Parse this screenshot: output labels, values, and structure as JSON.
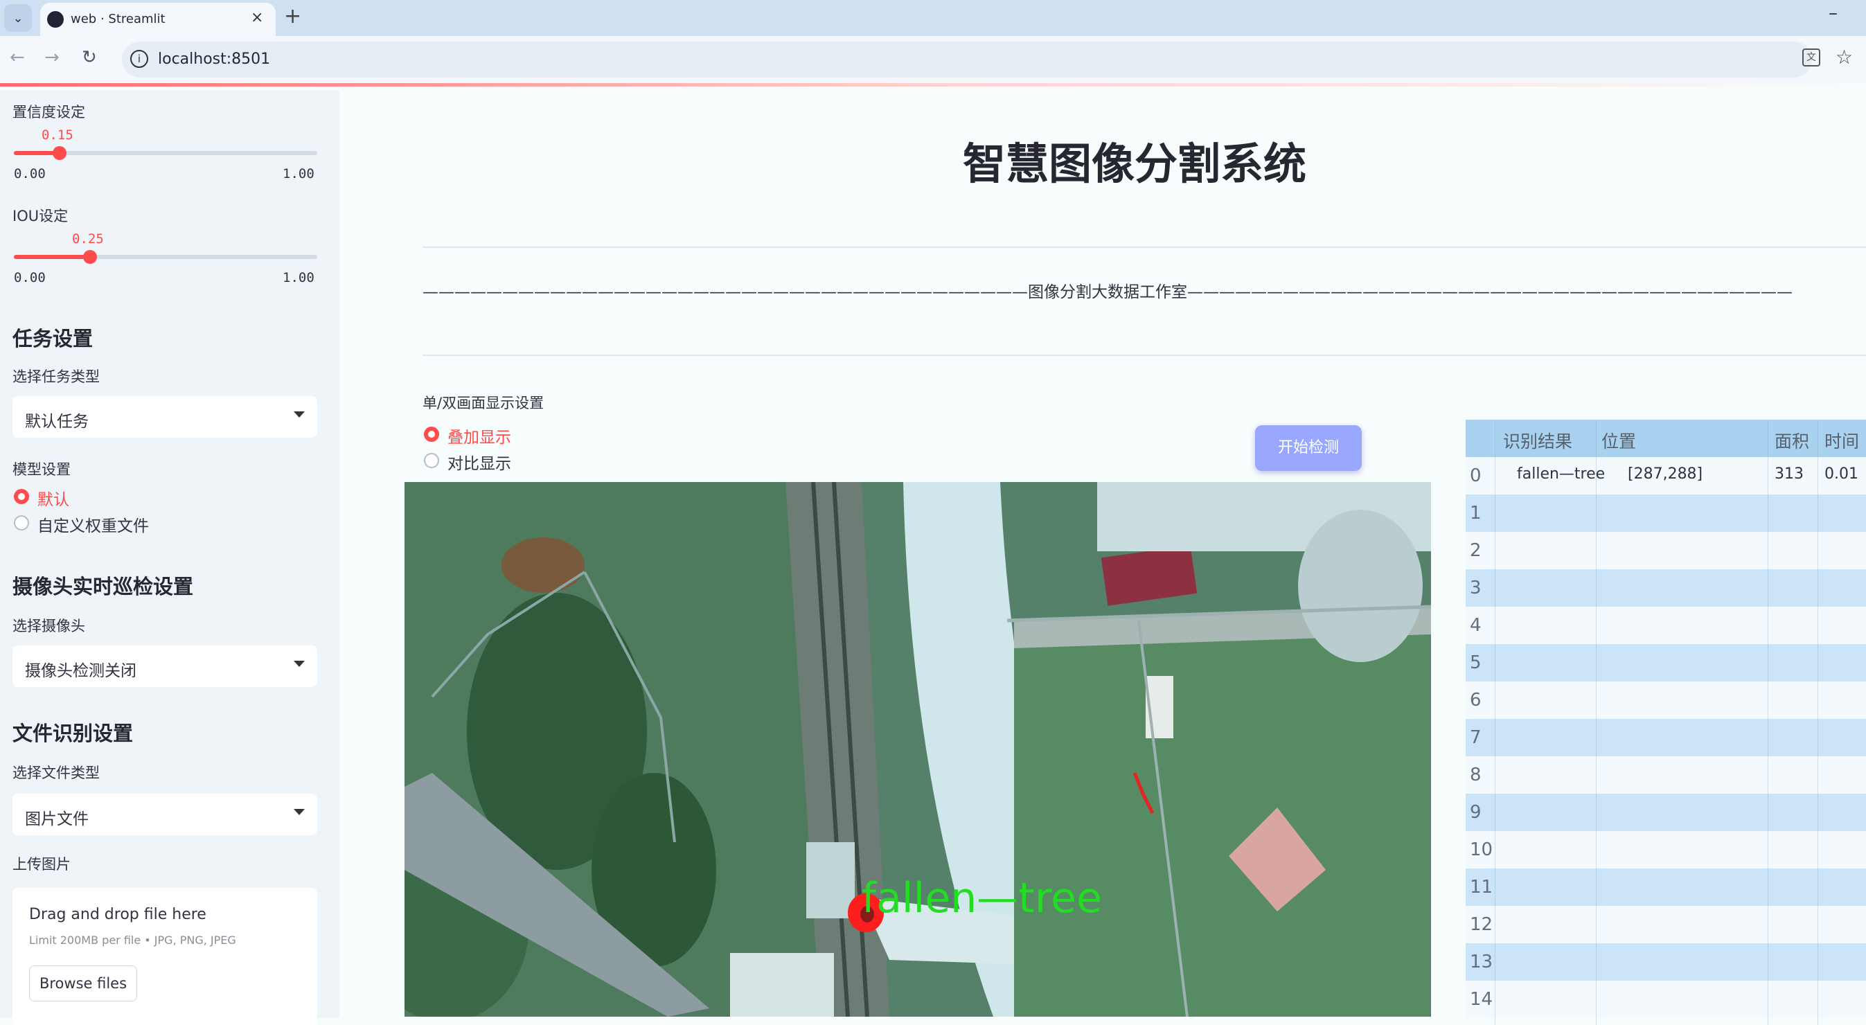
{
  "browser": {
    "tab_title": "web · Streamlit",
    "url": "localhost:8501"
  },
  "sidebar": {
    "confidence": {
      "label": "置信度设定",
      "value_text": "0.15",
      "value": 0.15,
      "min": "0.00",
      "max": "1.00"
    },
    "iou": {
      "label": "IOU设定",
      "value_text": "0.25",
      "value": 0.25,
      "min": "0.00",
      "max": "1.00"
    },
    "task_section": {
      "header": "任务设置",
      "type_label": "选择任务类型",
      "type_value": "默认任务",
      "model_label": "模型设置",
      "model_options": [
        "默认",
        "自定义权重文件"
      ],
      "model_selected": 0
    },
    "camera_section": {
      "header": "摄像头实时巡检设置",
      "camera_label": "选择摄像头",
      "camera_value": "摄像头检测关闭"
    },
    "file_section": {
      "header": "文件识别设置",
      "type_label": "选择文件类型",
      "type_value": "图片文件",
      "upload_label": "上传图片",
      "drop_text": "Drag and drop file here",
      "limit_text": "Limit 200MB per file • JPG, PNG, JPEG",
      "browse_label": "Browse files"
    }
  },
  "main": {
    "title": "智慧图像分割系统",
    "subtitle_line": "——————————————————————————————————————图像分割大数据工作室——————————————————————————————————————",
    "display_mode_label": "单/双画面显示设置",
    "display_options": [
      "叠加显示",
      "对比显示"
    ],
    "display_selected": 0,
    "start_button": "开始检测",
    "detection_label": "fallen—tree"
  },
  "results_table": {
    "columns": [
      "识别结果",
      "位置",
      "面积",
      "时间"
    ],
    "rows": [
      {
        "index": "0",
        "result": "fallen—tree",
        "position": "[287,288]",
        "area": "313",
        "time": "0.01"
      },
      {
        "index": "1"
      },
      {
        "index": "2"
      },
      {
        "index": "3"
      },
      {
        "index": "4"
      },
      {
        "index": "5"
      },
      {
        "index": "6"
      },
      {
        "index": "7"
      },
      {
        "index": "8"
      },
      {
        "index": "9"
      },
      {
        "index": "10"
      },
      {
        "index": "11"
      },
      {
        "index": "12"
      },
      {
        "index": "13"
      },
      {
        "index": "14"
      }
    ]
  },
  "colors": {
    "accent": "#ff4b4b",
    "button": "#9aa7ff",
    "table_header": "#a9d2f1",
    "detection_text": "#22dd22",
    "detection_mask": "#ff1e1e"
  }
}
